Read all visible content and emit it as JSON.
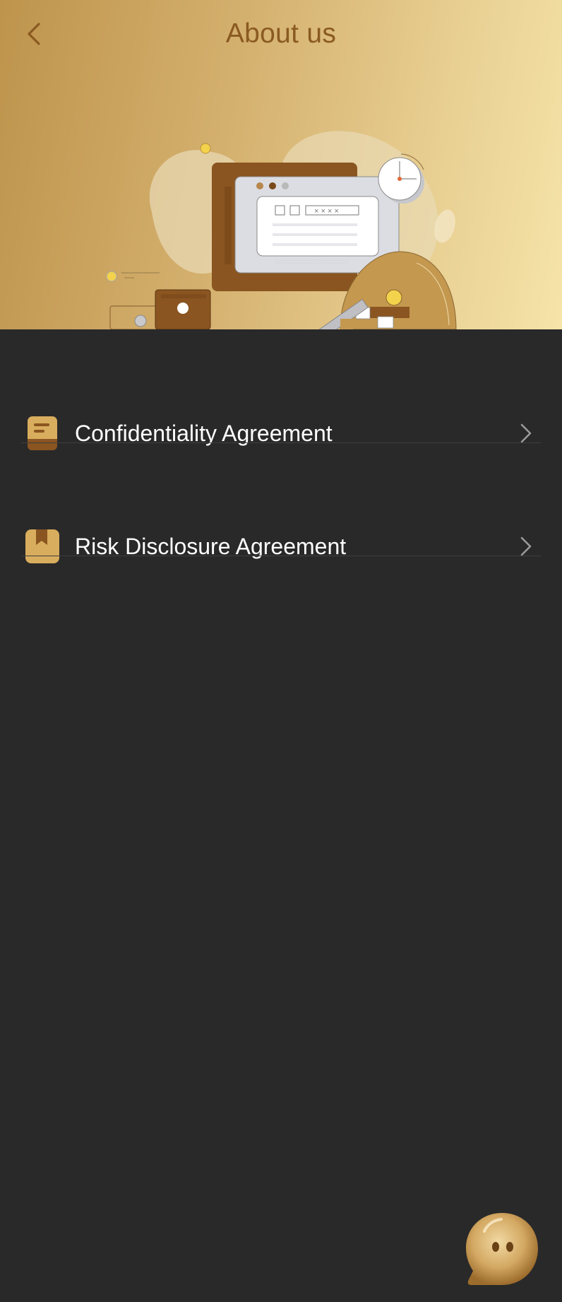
{
  "header": {
    "title": "About us",
    "back_icon": "chevron-left-icon"
  },
  "menu": {
    "items": [
      {
        "label": "Confidentiality Agreement",
        "icon": "document-icon"
      },
      {
        "label": "Risk Disclosure Agreement",
        "icon": "bookmark-icon"
      }
    ]
  },
  "floating": {
    "chat_icon": "chat-assistant-icon"
  },
  "colors": {
    "background": "#292929",
    "accent": "#8a5a22",
    "gold": "#c9a25c",
    "text": "#ffffff"
  }
}
